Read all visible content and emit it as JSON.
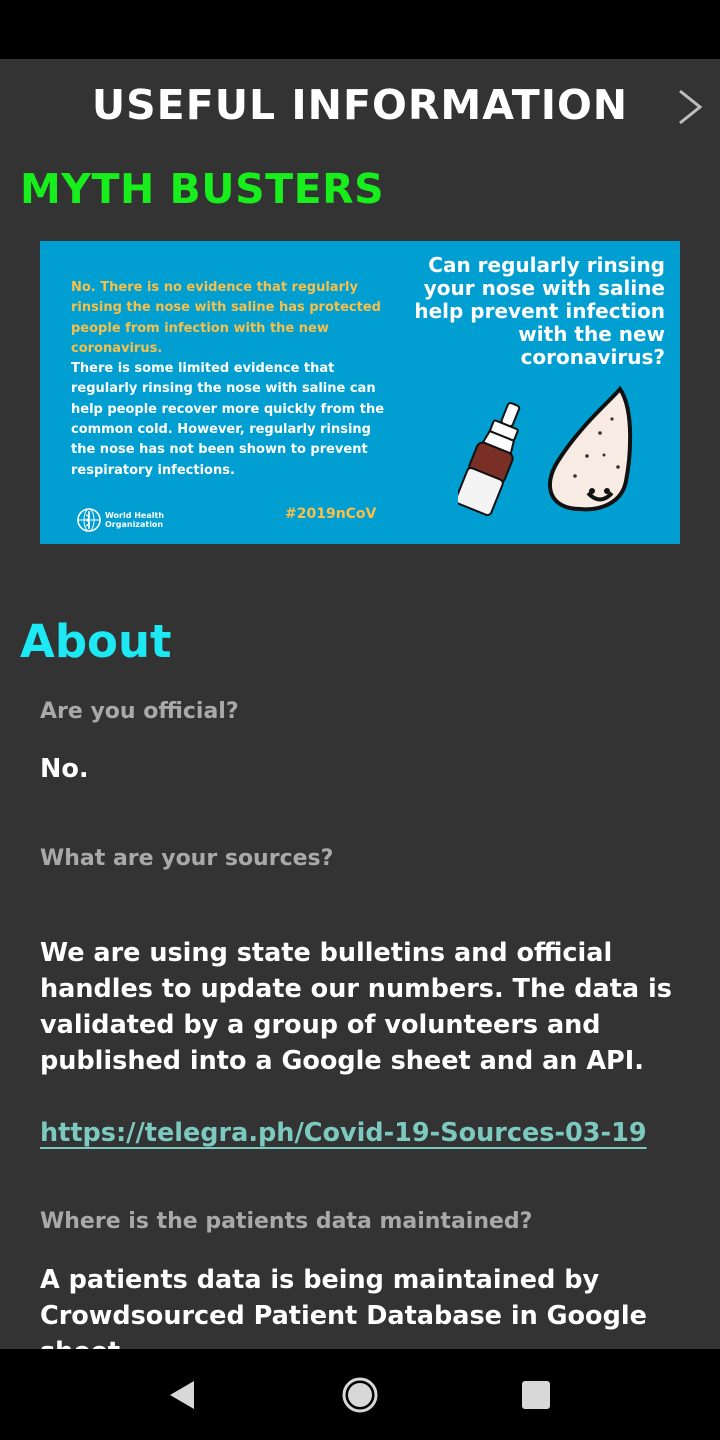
{
  "header": {
    "title": "USEFUL INFORMATION",
    "next_icon": "chevron-right-icon"
  },
  "myth_busters": {
    "title": "MYTH BUSTERS",
    "card": {
      "answer_no": "No. There is no evidence that regularly rinsing the nose with saline has protected people from infection with the new coronavirus.",
      "answer_more": "There is some limited evidence that regularly rinsing the nose with saline can help people recover more quickly from the common cold. However, regularly rinsing the nose has not been shown to prevent respiratory infections.",
      "question": "Can regularly rinsing your nose with saline help prevent infection with the new coronavirus?",
      "org_line1": "World Health",
      "org_line2": "Organization",
      "hashtag": "#2019nCoV"
    }
  },
  "about": {
    "title": "About",
    "faqs": [
      {
        "question": "Are you official?",
        "answer": "No."
      },
      {
        "question": "What are your sources?",
        "answer": "We are using state bulletins and official handles to update our numbers. The data is validated by a group of volunteers and published into a Google sheet and an API.",
        "link": "https://telegra.ph/Covid-19-Sources-03-19"
      },
      {
        "question": "Where is the patients data maintained?",
        "answer": "A patients data is being maintained by Crowdsourced Patient Database in Google sheet."
      }
    ]
  },
  "colors": {
    "myth_title": "#17ee1c",
    "about_title": "#1de9f5",
    "card_bg": "#019ed1",
    "answer_highlight": "#f7c04a",
    "link": "#7cc9c0",
    "background": "#333333"
  },
  "nav": {
    "back_icon": "back-triangle-icon",
    "home_icon": "home-circle-icon",
    "recents_icon": "recents-square-icon"
  }
}
